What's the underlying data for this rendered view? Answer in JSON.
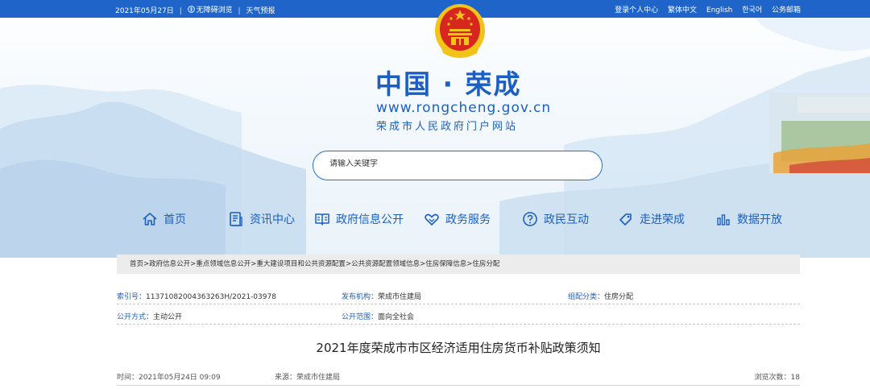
{
  "topbar": {
    "date": "2021年05月27日",
    "accessibility": "无障碍浏览",
    "weather": "天气预报",
    "links": [
      "登录个人中心",
      "繁体中文",
      "English",
      "한국어",
      "公务邮箱"
    ]
  },
  "logo": {
    "title": "中国 · 荣成",
    "url": "www.rongcheng.gov.cn",
    "subtitle": "荣成市人民政府门户网站"
  },
  "search": {
    "placeholder": "请输入关键字"
  },
  "nav": [
    {
      "label": "首页",
      "icon": "home-icon"
    },
    {
      "label": "资讯中心",
      "icon": "news-icon"
    },
    {
      "label": "政府信息公开",
      "icon": "book-icon"
    },
    {
      "label": "政务服务",
      "icon": "handshake-icon"
    },
    {
      "label": "政民互动",
      "icon": "question-icon"
    },
    {
      "label": "走进荣成",
      "icon": "tag-icon"
    },
    {
      "label": "数据开放",
      "icon": "chart-icon"
    }
  ],
  "breadcrumb": [
    "首页",
    "政府信息公开",
    "重点领域信息公开",
    "重大建设项目和公共资源配置",
    "公共资源配置领域信息",
    "住房保障信息",
    "住房分配"
  ],
  "breadcrumb_separator": ">",
  "meta": {
    "index_label": "索引号：",
    "index_value": "11371082004363263H/2021-03978",
    "publisher_label": "发布机构：",
    "publisher_value": "荣成市住建局",
    "category_label": "组配分类：",
    "category_value": "住房分配",
    "method_label": "公开方式：",
    "method_value": "主动公开",
    "scope_label": "公开范围：",
    "scope_value": "面向全社会"
  },
  "document": {
    "title": "2021年度荣成市市区经济适用住房货币补贴政策须知",
    "time": "时间：2021年05月24日 09:09",
    "source": "来源：荣成市住建局",
    "views_label": "浏览次数：",
    "views": "18"
  },
  "colors": {
    "primary": "#1f64c8",
    "link": "#1c5fc4",
    "emblem_red": "#d7261e",
    "emblem_gold": "#f2c318"
  }
}
